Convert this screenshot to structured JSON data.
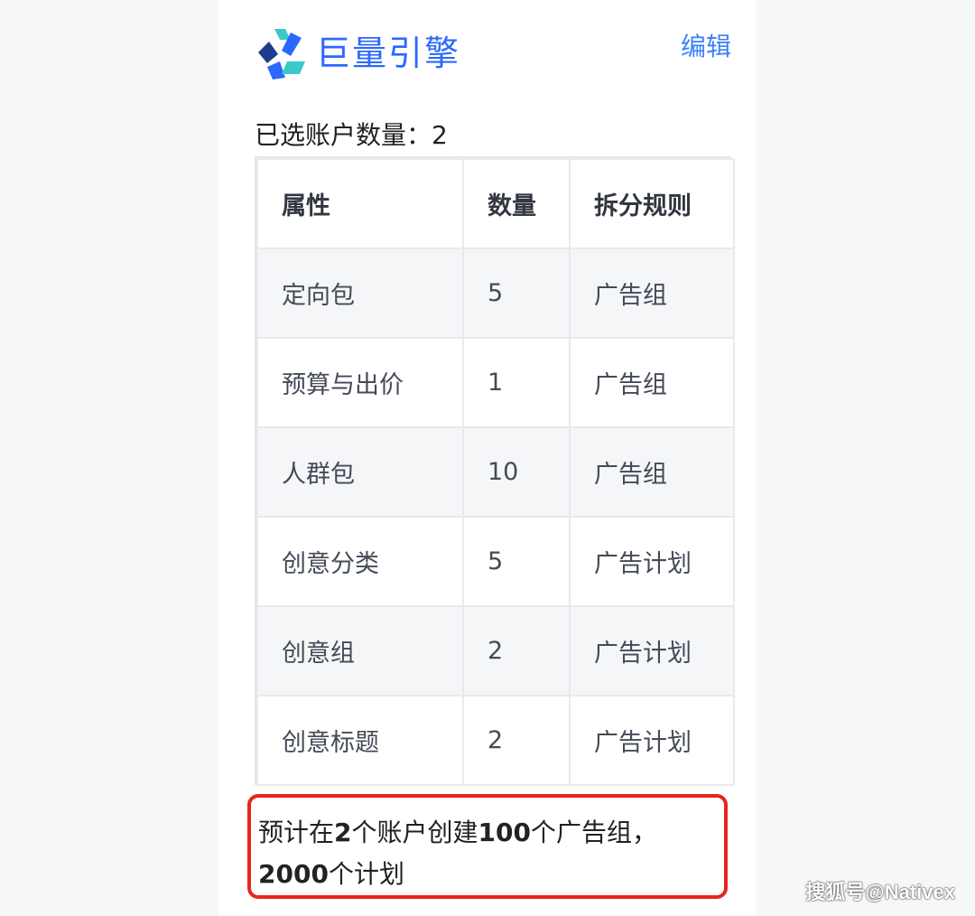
{
  "header": {
    "logo_text": "巨量引擎",
    "edit_label": "编辑",
    "brand_colors": [
      "#2b68ff",
      "#3cc8c8",
      "#1e3c8c"
    ]
  },
  "account": {
    "label": "已选账户数量：",
    "value": "2"
  },
  "table": {
    "headers": [
      "属性",
      "数量",
      "拆分规则"
    ],
    "rows": [
      [
        "定向包",
        "5",
        "广告组"
      ],
      [
        "预算与出价",
        "1",
        "广告组"
      ],
      [
        "人群包",
        "10",
        "广告组"
      ],
      [
        "创意分类",
        "5",
        "广告计划"
      ],
      [
        "创意组",
        "2",
        "广告计划"
      ],
      [
        "创意标题",
        "2",
        "广告计划"
      ]
    ]
  },
  "summary": {
    "part1": "预计在",
    "accounts": "2",
    "part2": "个账户创建",
    "groups": "100",
    "part3": "个广告组，",
    "plans": "2000",
    "part4": "个计划",
    "border_color": "#e4271f"
  },
  "watermark": "搜狐号@Nativex"
}
